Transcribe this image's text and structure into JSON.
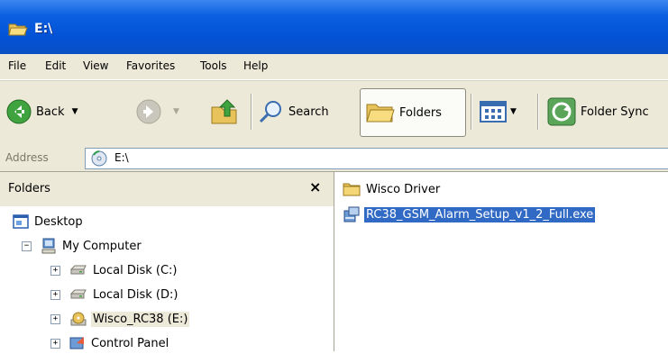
{
  "window": {
    "title": "E:\\"
  },
  "menu": [
    "File",
    "Edit",
    "View",
    "Favorites",
    "Tools",
    "Help"
  ],
  "toolbar": {
    "back_label": "Back",
    "search_label": "Search",
    "folders_label": "Folders",
    "folder_sync_label": "Folder Sync"
  },
  "address": {
    "label": "Address",
    "value": "E:\\"
  },
  "folders_pane": {
    "title": "Folders",
    "close": "×",
    "tree": [
      {
        "label": "Desktop",
        "icon": "desktop-icon"
      },
      {
        "label": "My Computer",
        "icon": "computer-icon",
        "expander": "−"
      },
      {
        "label": "Local Disk (C:)",
        "icon": "drive-icon",
        "expander": "+"
      },
      {
        "label": "Local Disk (D:)",
        "icon": "drive-icon",
        "expander": "+"
      },
      {
        "label": "Wisco_RC38 (E:)",
        "icon": "cd-drive-icon",
        "expander": "+"
      },
      {
        "label": "Control Panel",
        "icon": "control-panel-icon",
        "expander": "+"
      }
    ]
  },
  "files": [
    {
      "name": "Wisco Driver",
      "icon": "folder-icon"
    },
    {
      "name": "RC38_GSM_Alarm_Setup_v1_2_Full.exe",
      "icon": "setup-exe-icon",
      "selected": true
    }
  ],
  "colors": {
    "titlebar": "#0352d6",
    "selection": "#316ac5",
    "chrome": "#ece9d8"
  }
}
